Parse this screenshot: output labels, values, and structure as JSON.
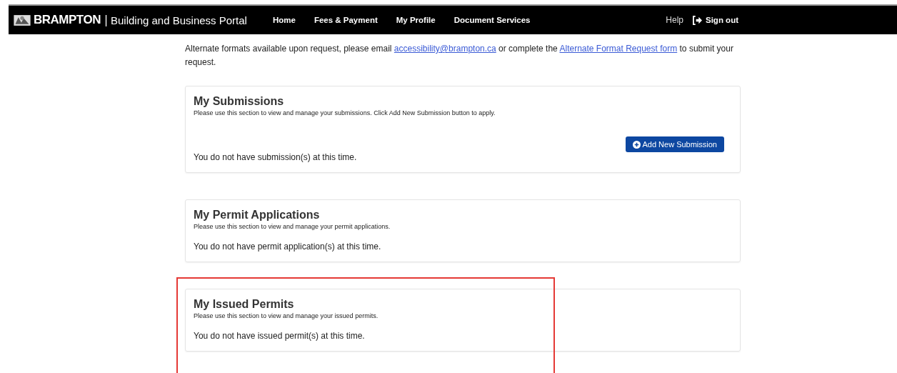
{
  "nav": {
    "brand": "BRAMPTON",
    "separator": "|",
    "portal": "Building and Business Portal",
    "links": [
      "Home",
      "Fees & Payment",
      "My Profile",
      "Document Services"
    ],
    "help": "Help",
    "sign_out": "Sign out"
  },
  "notice": {
    "before": "Alternate formats available upon request, please email ",
    "email": "accessibility@brampton.ca",
    "middle": " or complete the ",
    "form_link": "Alternate Format Request form",
    "after": " to submit your request."
  },
  "sections": [
    {
      "title": "My Submissions",
      "description": "Please use this section to view and manage your submissions. Click Add New Submission button to apply.",
      "button": "Add New Submission",
      "empty": "You do not have submission(s) at this time.",
      "highlighted": false
    },
    {
      "title": "My Permit Applications",
      "description": "Please use this section to view and manage your permit applications.",
      "empty": "You do not have permit application(s) at this time.",
      "highlighted": false
    },
    {
      "title": "My Issued Permits",
      "description": "Please use this section to view and manage your issued permits.",
      "empty": "You do not have issued permit(s) at this time.",
      "highlighted": true
    }
  ]
}
